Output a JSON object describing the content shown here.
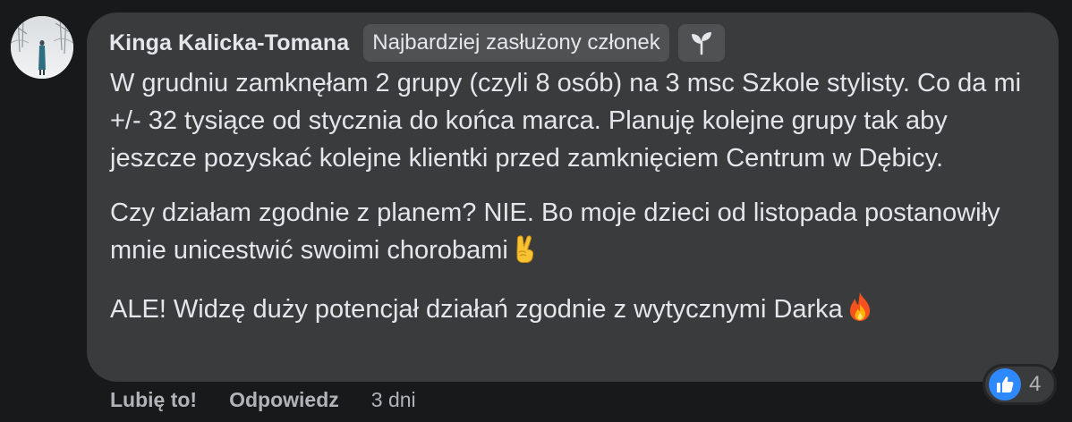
{
  "comment": {
    "author": "Kinga Kalicka-Tomana",
    "badge_label": "Najbardziej zasłużony członek",
    "badge_icon": "sprout-icon",
    "paragraphs": [
      "W grudniu zamknęłam 2 grupy (czyli 8 osób) na 3 msc Szkole stylisty. Co da mi +/- 32 tysiące od stycznia do końca marca. Planuję kolejne grupy tak aby jeszcze pozyskać kolejne klientki przed zamknięciem Centrum w Dębicy.",
      "Czy działam zgodnie z planem? NIE. Bo moje dzieci od listopada postanowiły mnie unicestwić swoimi chorobami",
      "ALE! Widzę duży potencjał działań zgodnie z wytycznymi Darka"
    ],
    "paragraph_emojis": [
      "",
      "victory-hand-icon",
      "fire-icon"
    ]
  },
  "actions": {
    "like_label": "Lubię to!",
    "reply_label": "Odpowiedz",
    "timestamp": "3 dni"
  },
  "reactions": {
    "icon": "thumbs-up-icon",
    "count": "4"
  },
  "colors": {
    "background": "#18191a",
    "bubble": "#3a3b3c",
    "text": "#e4e6eb",
    "secondary_text": "#b0b3b8",
    "like_blue": "#2e89ff"
  }
}
